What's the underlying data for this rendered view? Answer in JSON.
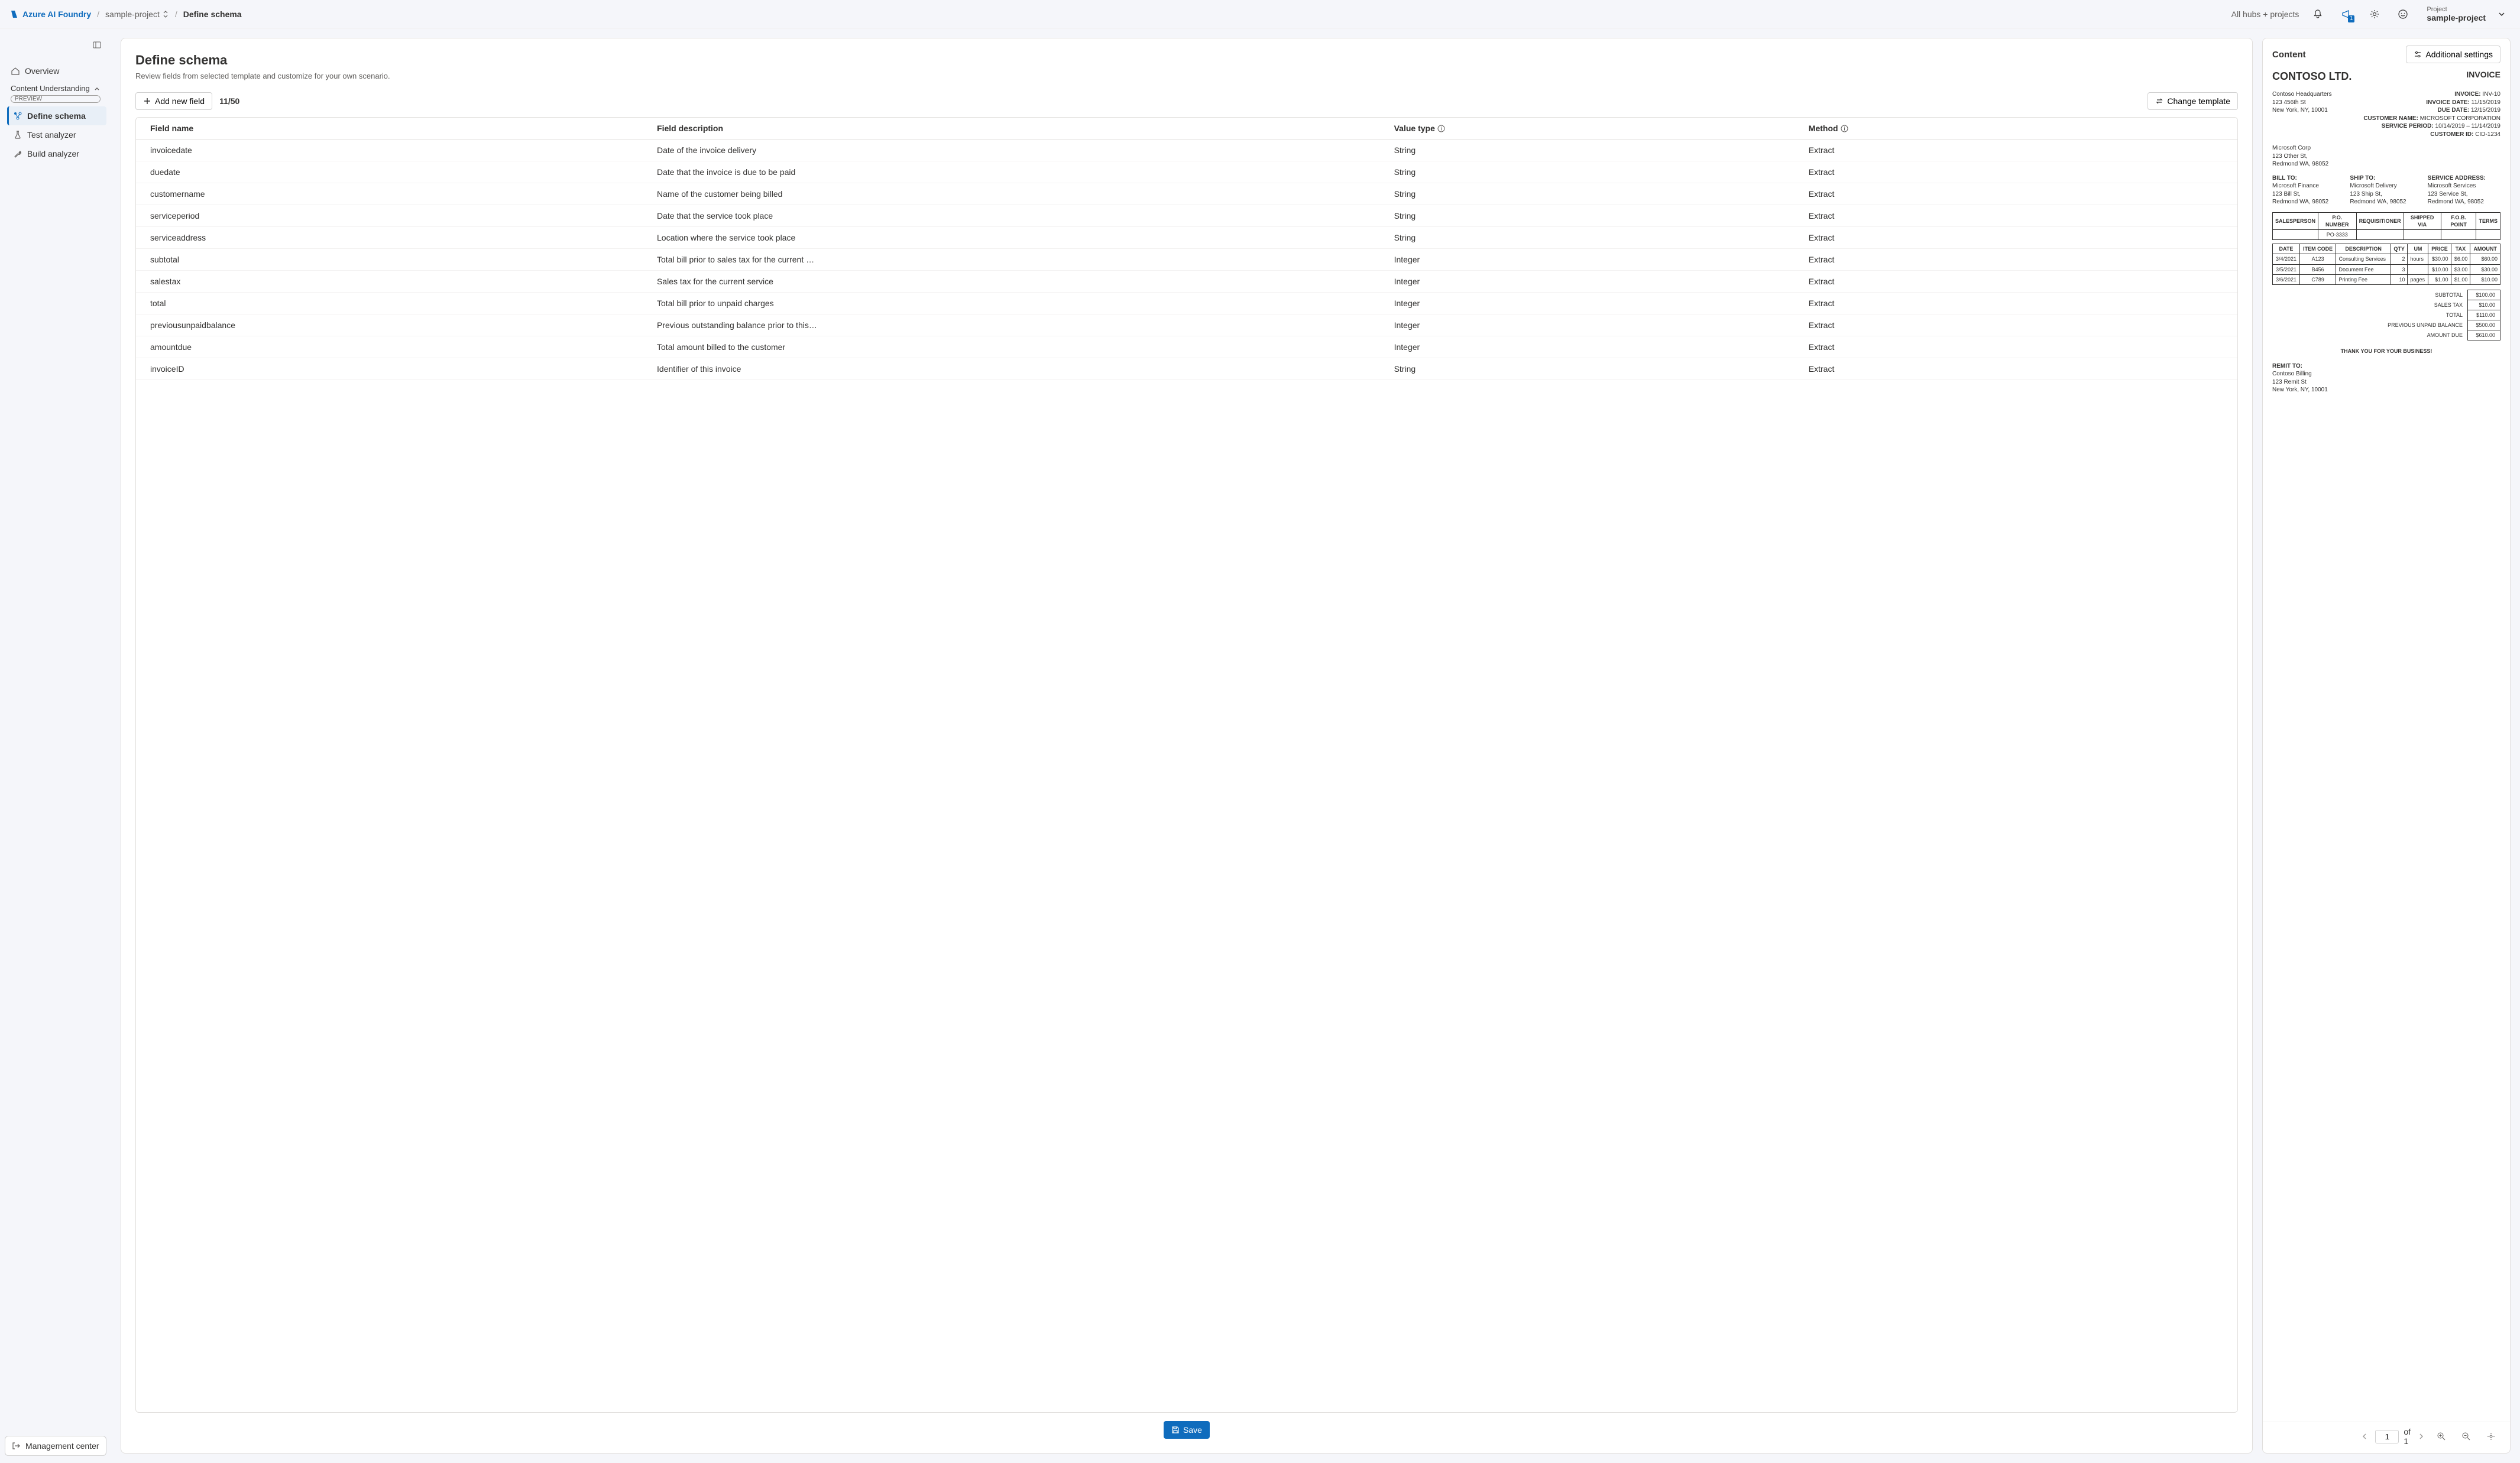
{
  "header": {
    "brand": "Azure AI Foundry",
    "breadcrumb_project": "sample-project",
    "breadcrumb_current": "Define schema",
    "hubs_label": "All hubs + projects",
    "announce_badge": "1",
    "project_label": "Project",
    "project_value": "sample-project"
  },
  "sidebar": {
    "overview": "Overview",
    "section": "Content Understanding",
    "preview_tag": "PREVIEW",
    "items": {
      "define": "Define schema",
      "test": "Test analyzer",
      "build": "Build analyzer"
    },
    "management": "Management center"
  },
  "page": {
    "title": "Define schema",
    "subtitle": "Review fields from selected template and customize for your own scenario.",
    "add_field": "Add new field",
    "counter": "11/50",
    "change_template": "Change template",
    "save": "Save",
    "columns": {
      "name": "Field name",
      "desc": "Field description",
      "type": "Value type",
      "method": "Method"
    },
    "rows": [
      {
        "name": "invoicedate",
        "desc": "Date of the invoice delivery",
        "type": "String",
        "method": "Extract"
      },
      {
        "name": "duedate",
        "desc": "Date that the invoice is due to be paid",
        "type": "String",
        "method": "Extract"
      },
      {
        "name": "customername",
        "desc": "Name of the customer being billed",
        "type": "String",
        "method": "Extract"
      },
      {
        "name": "serviceperiod",
        "desc": "Date that the service took place",
        "type": "String",
        "method": "Extract"
      },
      {
        "name": "serviceaddress",
        "desc": "Location where the service took place",
        "type": "String",
        "method": "Extract"
      },
      {
        "name": "subtotal",
        "desc": "Total bill prior to sales tax for the current …",
        "type": "Integer",
        "method": "Extract"
      },
      {
        "name": "salestax",
        "desc": "Sales tax for the current service",
        "type": "Integer",
        "method": "Extract"
      },
      {
        "name": "total",
        "desc": "Total bill prior to unpaid charges",
        "type": "Integer",
        "method": "Extract"
      },
      {
        "name": "previousunpaidbalance",
        "desc": "Previous outstanding balance prior to this…",
        "type": "Integer",
        "method": "Extract"
      },
      {
        "name": "amountdue",
        "desc": "Total amount billed to the customer",
        "type": "Integer",
        "method": "Extract"
      },
      {
        "name": "invoiceID",
        "desc": "Identifier of this invoice",
        "type": "String",
        "method": "Extract"
      }
    ]
  },
  "preview": {
    "title": "Content",
    "settings_label": "Additional settings",
    "pager": {
      "page": "1",
      "of": "of 1"
    },
    "invoice": {
      "company": "CONTOSO LTD.",
      "word": "INVOICE",
      "hq": [
        "Contoso Headquarters",
        "123 456th St",
        "New York, NY, 10001"
      ],
      "meta": [
        {
          "k": "INVOICE:",
          "v": "INV-10"
        },
        {
          "k": "INVOICE DATE:",
          "v": "11/15/2019"
        },
        {
          "k": "DUE DATE:",
          "v": "12/15/2019"
        },
        {
          "k": "CUSTOMER NAME:",
          "v": "MICROSOFT CORPORATION"
        },
        {
          "k": "SERVICE PERIOD:",
          "v": "10/14/2019 – 11/14/2019"
        },
        {
          "k": "CUSTOMER ID:",
          "v": "CID-1234"
        }
      ],
      "customer": [
        "Microsoft Corp",
        "123 Other St,",
        "Redmond WA, 98052"
      ],
      "bill": {
        "h": "BILL TO:",
        "l": [
          "Microsoft Finance",
          "123 Bill St,",
          "Redmond WA, 98052"
        ]
      },
      "ship": {
        "h": "SHIP TO:",
        "l": [
          "Microsoft Delivery",
          "123 Ship St,",
          "Redmond WA, 98052"
        ]
      },
      "service": {
        "h": "SERVICE ADDRESS:",
        "l": [
          "Microsoft Services",
          "123 Service St,",
          "Redmond WA, 98052"
        ]
      },
      "hdr_cols": [
        "SALESPERSON",
        "P.O. NUMBER",
        "REQUISITIONER",
        "SHIPPED VIA",
        "F.O.B. POINT",
        "TERMS"
      ],
      "hdr_vals": [
        "",
        "PO-3333",
        "",
        "",
        "",
        ""
      ],
      "item_cols": [
        "DATE",
        "ITEM CODE",
        "DESCRIPTION",
        "QTY",
        "UM",
        "PRICE",
        "TAX",
        "AMOUNT"
      ],
      "items": [
        {
          "date": "3/4/2021",
          "code": "A123",
          "desc": "Consulting Services",
          "qty": "2",
          "um": "hours",
          "price": "$30.00",
          "tax": "$6.00",
          "amt": "$60.00"
        },
        {
          "date": "3/5/2021",
          "code": "B456",
          "desc": "Document Fee",
          "qty": "3",
          "um": "",
          "price": "$10.00",
          "tax": "$3.00",
          "amt": "$30.00"
        },
        {
          "date": "3/6/2021",
          "code": "C789",
          "desc": "Printing Fee",
          "qty": "10",
          "um": "pages",
          "price": "$1.00",
          "tax": "$1.00",
          "amt": "$10.00"
        }
      ],
      "totals": [
        {
          "k": "SUBTOTAL",
          "v": "$100.00"
        },
        {
          "k": "SALES TAX",
          "v": "$10.00"
        },
        {
          "k": "TOTAL",
          "v": "$110.00"
        },
        {
          "k": "PREVIOUS UNPAID BALANCE",
          "v": "$500.00"
        },
        {
          "k": "AMOUNT DUE",
          "v": "$610.00"
        }
      ],
      "thanks": "THANK YOU FOR YOUR BUSINESS!",
      "remit": {
        "h": "REMIT TO:",
        "l": [
          "Contoso Billing",
          "123 Remit St",
          "New York, NY, 10001"
        ]
      }
    }
  }
}
